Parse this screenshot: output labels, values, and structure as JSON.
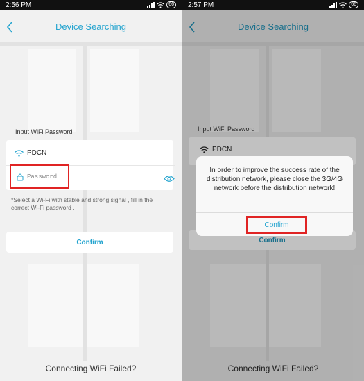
{
  "left": {
    "status": {
      "time": "2:56 PM",
      "battery": "66"
    },
    "title": "Device Searching",
    "input_label": "Input WiFi Password",
    "ssid": "PDCN",
    "password_placeholder": "Password",
    "hint": "*Select a Wi-Fi with stable and strong signal , fill in the correct Wi-Fi password .",
    "confirm_label": "Confirm",
    "footer": "Connecting WiFi Failed?"
  },
  "right": {
    "status": {
      "time": "2:57 PM",
      "battery": "66"
    },
    "title": "Device Searching",
    "input_label": "Input WiFi Password",
    "ssid": "PDCN",
    "confirm_label": "Confirm",
    "footer": "Connecting WiFi Failed?",
    "dialog": {
      "message": "In order to improve the success rate of the distribution network, please close the 3G/4G network before the distribution network!",
      "confirm_label": "Confirm"
    }
  },
  "colors": {
    "accent": "#24a4cf",
    "highlight": "#e02424"
  },
  "icons": [
    "back-chevron-icon",
    "wifi-icon",
    "lock-icon",
    "eye-icon",
    "signal-icon",
    "battery-icon"
  ]
}
